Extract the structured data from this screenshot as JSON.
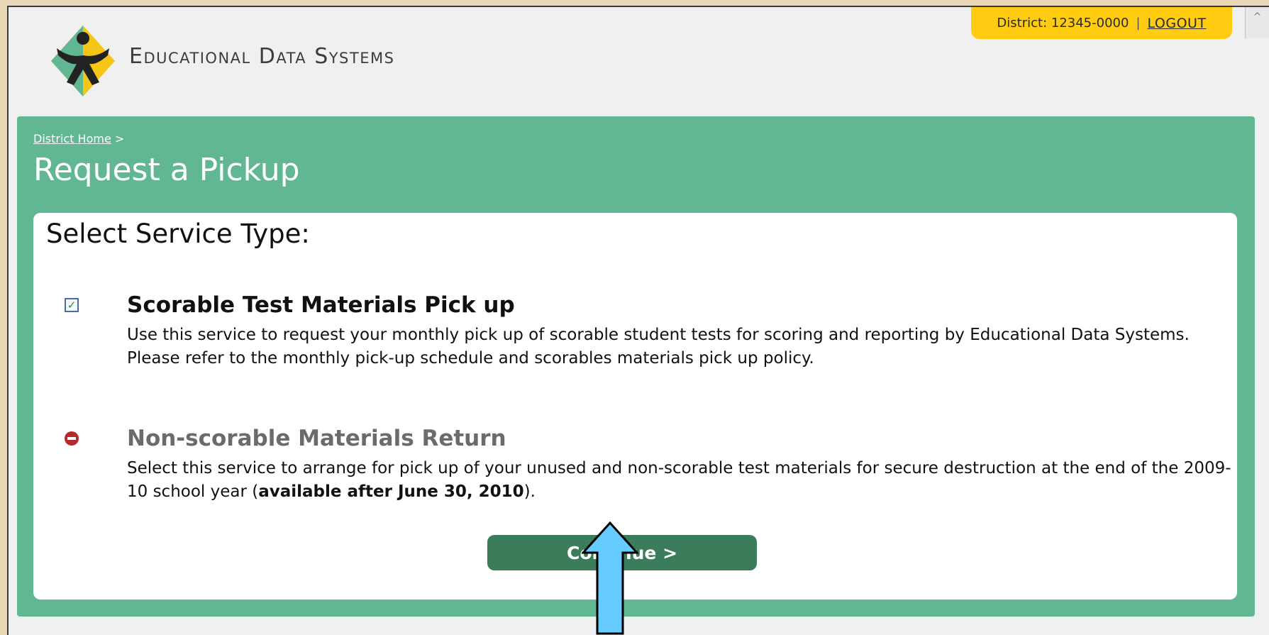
{
  "header": {
    "brand": "Educational Data Systems",
    "district_label": "District: 12345-0000",
    "separator": "|",
    "logout_label": "LOGOUT",
    "scroll_glyph": "^",
    "logo_icon": "edu-logo-icon",
    "logo_colors": {
      "yellow": "#f5c518",
      "green": "#61b792",
      "figure": "#222222"
    }
  },
  "breadcrumb": {
    "home_label": "District Home",
    "arrow": ">"
  },
  "page": {
    "title": "Request a Pickup"
  },
  "card": {
    "heading": "Select Service Type:",
    "options": [
      {
        "icon": "checkbox-checked-icon",
        "state": "checked",
        "title": "Scorable Test Materials Pick up",
        "description": "Use this service to request your monthly pick up of scorable student tests for scoring and reporting by Educational Data Systems. Please refer to the monthly pick-up schedule and scorables materials pick up policy."
      },
      {
        "icon": "no-entry-icon",
        "state": "unavailable",
        "title": "Non-scorable Materials Return",
        "description_before": "Select this service to arrange for pick up of your unused and non-scorable test materials for secure destruction at the end of the 2009-10 school year (",
        "description_bold": "available after June 30, 2010",
        "description_after": ")."
      }
    ],
    "continue_label": "Continue >"
  },
  "colors": {
    "green_panel": "#61b792",
    "button": "#3b7d5b",
    "district_pill": "#ffcc11",
    "arrow": "#66ccff",
    "outer_bg": "#e9d7b6"
  }
}
